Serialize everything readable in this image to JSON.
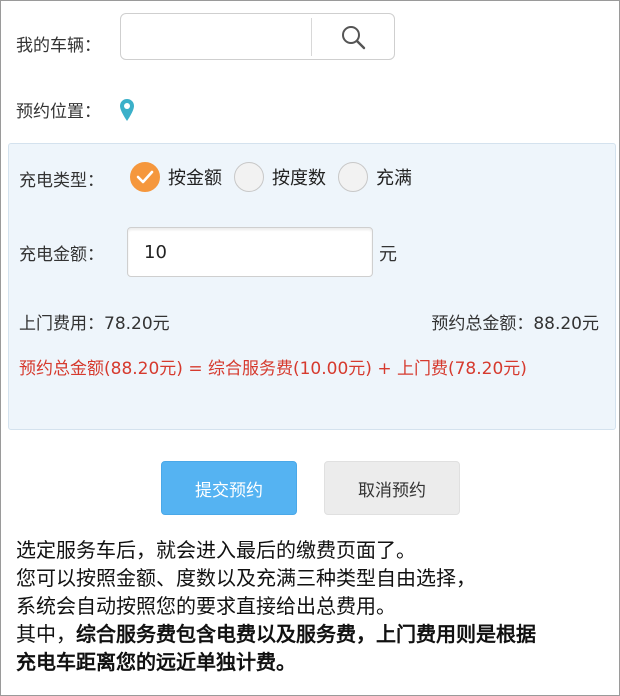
{
  "vehicle": {
    "label": "我的车辆：",
    "search_value": "",
    "search_icon": "search-icon"
  },
  "location": {
    "label": "预约位置：",
    "icon": "map-pin-icon",
    "pin_color": "#3bb0c9"
  },
  "charge": {
    "type_label": "充电类型：",
    "options": [
      {
        "label": "按金额",
        "selected": true
      },
      {
        "label": "按度数",
        "selected": false
      },
      {
        "label": "充满",
        "selected": false
      }
    ],
    "amount_label": "充电金额：",
    "amount_value": "10",
    "unit": "元",
    "visit_fee": "上门费用：78.20元",
    "total": "预约总金额：88.20元",
    "formula": "预约总金额(88.20元) = 综合服务费(10.00元) + 上门费(78.20元)"
  },
  "buttons": {
    "submit": "提交预约",
    "cancel": "取消预约"
  },
  "caption": {
    "line1": "选定服务车后，就会进入最后的缴费页面了。",
    "line2": "您可以按照金额、度数以及充满三种类型自由选择，",
    "line3": "系统会自动按照您的要求直接给出总费用。",
    "line4_prefix": "其中，",
    "line4_bold": "综合服务费包含电费以及服务费，上门费用则是根据",
    "line5_bold": "充电车距离您的远近单独计费。"
  },
  "colors": {
    "accent_orange": "#f5973d",
    "submit_blue": "#55b3f2",
    "formula_red": "#d63a2e",
    "panel_bg": "#eef5fb"
  }
}
